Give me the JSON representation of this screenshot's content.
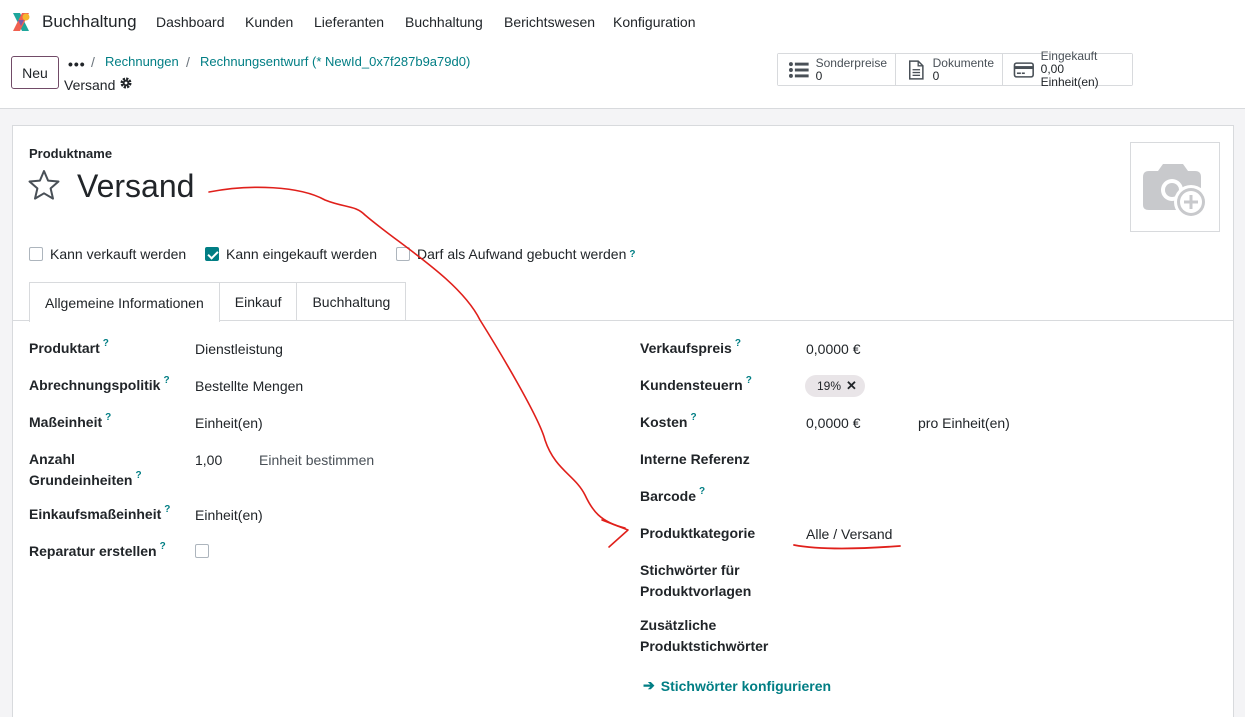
{
  "app": {
    "name": "Buchhaltung"
  },
  "nav": {
    "items": [
      "Dashboard",
      "Kunden",
      "Lieferanten",
      "Buchhaltung",
      "Berichtswesen",
      "Konfiguration"
    ]
  },
  "control": {
    "new_label": "Neu",
    "breadcrumb_more": "•••",
    "breadcrumb": [
      "Rechnungen",
      "Rechnungsentwurf (* NewId_0x7f287b9a79d0)"
    ],
    "record_name": "Versand"
  },
  "stats": [
    {
      "label": "Sonderpreise",
      "value": "0",
      "icon": "list-icon"
    },
    {
      "label": "Dokumente",
      "value": "0",
      "icon": "document-icon"
    },
    {
      "label": "Eingekauft",
      "value": "0,00 Einheit(en)",
      "icon": "credit-card-icon"
    }
  ],
  "form": {
    "name_label": "Produktname",
    "name": "Versand",
    "checkboxes": [
      {
        "label": "Kann verkauft werden",
        "checked": false,
        "help": ""
      },
      {
        "label": "Kann eingekauft werden",
        "checked": true,
        "help": ""
      },
      {
        "label": "Darf als Aufwand gebucht werden",
        "checked": false,
        "help": "?"
      }
    ],
    "tabs": [
      "Allgemeine Informationen",
      "Einkauf",
      "Buchhaltung"
    ],
    "left": {
      "produktart": {
        "label": "Produktart",
        "value": "Dienstleistung"
      },
      "abrechnung": {
        "label": "Abrechnungspolitik",
        "value": "Bestellte Mengen"
      },
      "masseinheit": {
        "label": "Maßeinheit",
        "value": "Einheit(en)"
      },
      "anzahl": {
        "label_1": "Anzahl",
        "label_2": "Grundeinheiten",
        "value": "1,00",
        "action": "Einheit bestimmen"
      },
      "einkaufsmass": {
        "label": "Einkaufsmaßeinheit",
        "value": "Einheit(en)"
      },
      "reparatur": {
        "label": "Reparatur erstellen"
      }
    },
    "right": {
      "verkaufspreis": {
        "label": "Verkaufspreis",
        "value": "0,0000 €"
      },
      "kundensteuern": {
        "label": "Kundensteuern",
        "tag": "19%",
        "tag_remove": "✕"
      },
      "kosten": {
        "label": "Kosten",
        "value": "0,0000 €",
        "unit": "pro Einheit(en)"
      },
      "referenz": {
        "label": "Interne Referenz"
      },
      "barcode": {
        "label": "Barcode"
      },
      "kategorie": {
        "label": "Produktkategorie",
        "value": "Alle / Versand"
      },
      "stichwoerter": {
        "label_1": "Stichwörter für",
        "label_2": "Produktvorlagen"
      },
      "zusatz": {
        "label_1": "Zusätzliche",
        "label_2": "Produktstichwörter"
      },
      "config_link": "Stichwörter konfigurieren"
    },
    "help_glyph": "?"
  },
  "colors": {
    "brand": "#714b67",
    "accent": "#017e84",
    "annotation": "#e0201b"
  }
}
